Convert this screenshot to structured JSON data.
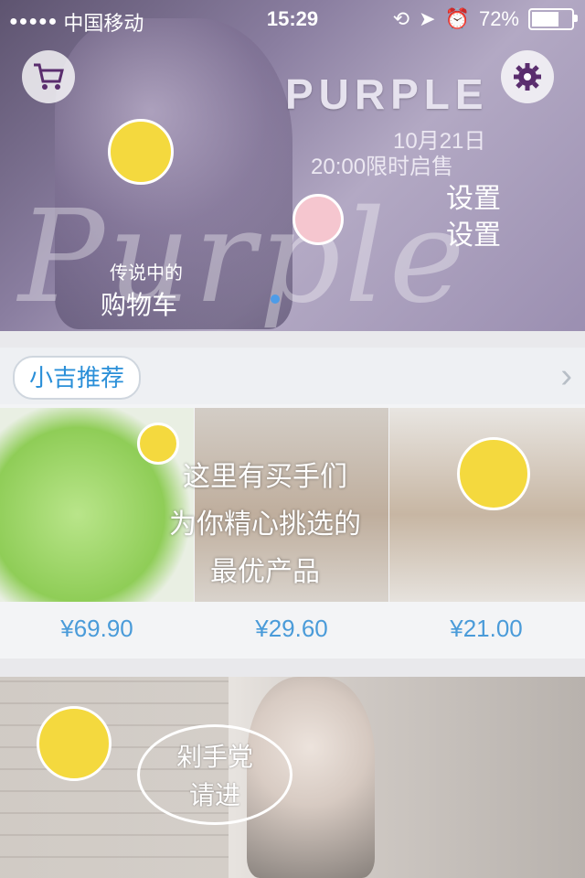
{
  "status_bar": {
    "carrier": "中国移动",
    "time": "15:29",
    "battery_percent": "72%",
    "battery_level": 0.72
  },
  "banner": {
    "brand": "PURPLE",
    "script_text": "Purple",
    "date": "10月21日",
    "sale_time": "20:00限时启售",
    "cart_note_line1": "传说中的",
    "cart_note_line2": "购物车",
    "settings_note_line1": "设置",
    "settings_note_line2": "设置"
  },
  "recommend": {
    "title": "小吉推荐",
    "overlay_note": [
      "这里有买手们",
      "为你精心挑选的",
      "最优产品"
    ],
    "products": [
      {
        "price": "¥69.90"
      },
      {
        "price": "¥29.60"
      },
      {
        "price": "¥21.00"
      }
    ]
  },
  "bottom_banner": {
    "bubble_line1": "剁手党",
    "bubble_line2": "请进"
  },
  "colors": {
    "accent": "#2a8fd8",
    "price": "#4a9bd9",
    "banner": "#8a7ea0"
  }
}
